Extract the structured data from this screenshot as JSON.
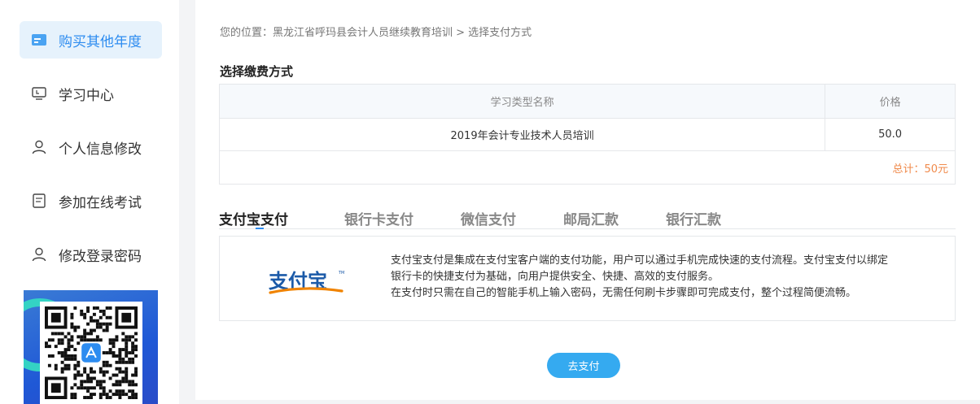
{
  "sidebar": {
    "items": [
      {
        "label": "购买其他年度",
        "icon": "card-icon",
        "active": true
      },
      {
        "label": "学习中心",
        "icon": "monitor-icon",
        "active": false
      },
      {
        "label": "个人信息修改",
        "icon": "user-icon",
        "active": false
      },
      {
        "label": "参加在线考试",
        "icon": "document-icon",
        "active": false
      },
      {
        "label": "修改登录密码",
        "icon": "user-icon",
        "active": false
      }
    ],
    "qr_icon": "qr-code-icon"
  },
  "breadcrumb": {
    "text": "您的位置：黑龙江省呼玛县会计人员继续教育培训 > 选择支付方式"
  },
  "section": {
    "title": "选择缴费方式"
  },
  "table": {
    "headers": [
      "学习类型名称",
      "价格"
    ],
    "rows": [
      [
        "2019年会计专业技术人员培训",
        "50.0"
      ]
    ],
    "total": "总计：50元"
  },
  "tabs": [
    {
      "label": "支付宝支付",
      "active": true
    },
    {
      "label": "银行卡支付",
      "active": false
    },
    {
      "label": "微信支付",
      "active": false
    },
    {
      "label": "邮局汇款",
      "active": false
    },
    {
      "label": "银行汇款",
      "active": false
    }
  ],
  "pay_panel": {
    "logo_text": "支付宝",
    "logo_tm": "TM",
    "desc_line1": "支付宝支付是集成在支付宝客户端的支付功能，用户可以通过手机完成快速的支付流程。支付宝支付以绑定",
    "desc_line2": "银行卡的快捷支付为基础，向用户提供安全、快捷、高效的支付服务。",
    "desc_line3": "在支付时只需在自己的智能手机上输入密码，无需任何刷卡步骤即可完成支付，整个过程简便流畅。"
  },
  "actions": {
    "pay_label": "去支付"
  },
  "colors": {
    "accent": "#2d8cf0",
    "button": "#35aaf0",
    "total": "#f08a4b",
    "alipay_blue": "#1b5aa8",
    "alipay_orange": "#f08300"
  }
}
